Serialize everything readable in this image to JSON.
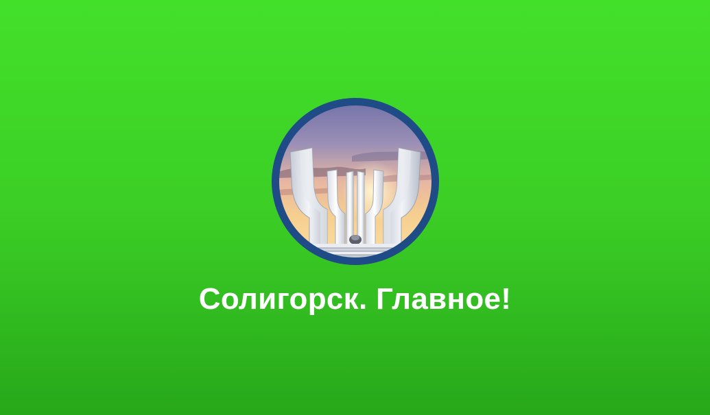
{
  "title": "Солигорск. Главное!",
  "logo": {
    "icon": "soligorsk-monument-logo",
    "ring_color": "#1f4b86"
  },
  "colors": {
    "background_top": "#43e02a",
    "background_bottom": "#27a81a",
    "title_text": "#ffffff"
  }
}
